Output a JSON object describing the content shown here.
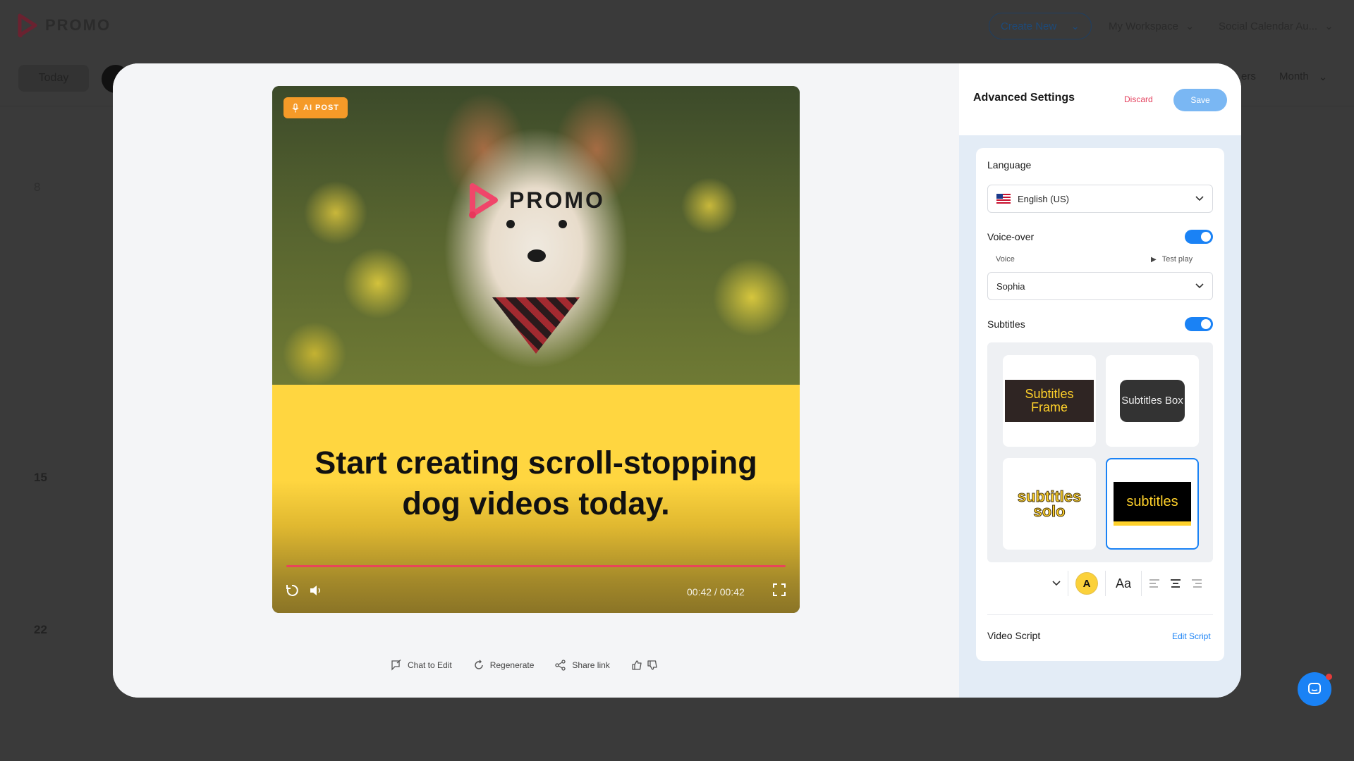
{
  "app": {
    "brand": "PROMO",
    "header": {
      "create_new": "Create New",
      "workspace": "My Workspace",
      "social_calendar": "Social Calendar Au..."
    },
    "calendar": {
      "today": "Today",
      "filters": "ers",
      "month": "Month",
      "days": [
        "8",
        "15",
        "22"
      ]
    }
  },
  "video": {
    "badge": "AI POST",
    "logo_text": "PROMO",
    "caption": "Start creating scroll-stopping dog videos today.",
    "time": "00:42 / 00:42",
    "progress_fraction": 1.0
  },
  "actions": {
    "chat_to_edit": "Chat to Edit",
    "regenerate": "Regenerate",
    "share_link": "Share link"
  },
  "settings": {
    "title": "Advanced Settings",
    "discard": "Discard",
    "save": "Save",
    "language_label": "Language",
    "language_value": "English (US)",
    "voiceover_label": "Voice-over",
    "voiceover_on": true,
    "voice_label": "Voice",
    "test_play": "Test play",
    "voice_value": "Sophia",
    "subtitles_label": "Subtitles",
    "subtitles_on": true,
    "styles": {
      "frame": "Subtitles Frame",
      "box": "Subtitles Box",
      "solo": "subtitles solo",
      "black": "subtitles",
      "selected": "black"
    },
    "text_style_glyph": "Aa",
    "color_glyph": "A",
    "video_script_label": "Video Script",
    "edit_script": "Edit Script"
  },
  "colors": {
    "accent": "#1a82f5",
    "badge": "#f59a28",
    "caption_bg": "#ffd640",
    "progress": "#e9445a",
    "discard": "#e4415e"
  }
}
